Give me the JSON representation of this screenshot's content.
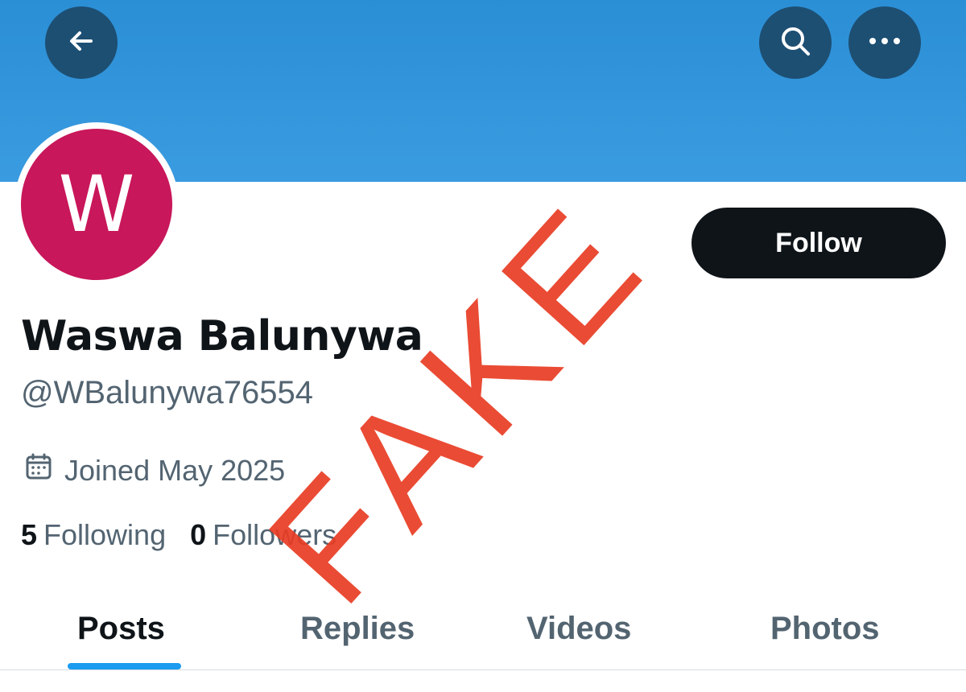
{
  "header": {
    "back_icon": "arrow-left-icon",
    "search_icon": "search-icon",
    "more_icon": "more-horizontal-icon",
    "banner_color": "#3a9be0"
  },
  "profile": {
    "avatar_letter": "W",
    "avatar_color": "#c8175a",
    "display_name": "Waswa Balunywa",
    "handle": "@WBalunywa76554",
    "joined_icon": "calendar-icon",
    "joined": "Joined May 2025",
    "following_count": "5",
    "following_label": "Following",
    "followers_count": "0",
    "followers_label": "Followers"
  },
  "actions": {
    "follow_label": "Follow"
  },
  "tabs": [
    {
      "label": "Posts",
      "active": true
    },
    {
      "label": "Replies",
      "active": false
    },
    {
      "label": "Videos",
      "active": false
    },
    {
      "label": "Photos",
      "active": false
    }
  ],
  "overlay": {
    "stamp_text": "FAKE",
    "stamp_color": "#e83c23"
  }
}
